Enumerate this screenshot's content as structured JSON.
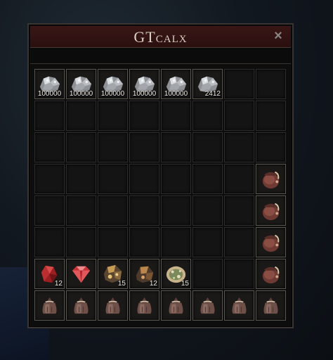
{
  "window": {
    "title": "GTcalx",
    "close_label": "×"
  },
  "grid": {
    "rows": [
      [
        {
          "item": "silver-ore-icon",
          "qty": "100000"
        },
        {
          "item": "silver-ore-icon",
          "qty": "100000"
        },
        {
          "item": "silver-ore-icon",
          "qty": "100000"
        },
        {
          "item": "silver-ore-icon",
          "qty": "100000"
        },
        {
          "item": "silver-ore-icon",
          "qty": "100000"
        },
        {
          "item": "silver-ore-icon",
          "qty": "2412"
        },
        null,
        null
      ],
      [
        null,
        null,
        null,
        null,
        null,
        null,
        null,
        null
      ],
      [
        null,
        null,
        null,
        null,
        null,
        null,
        null,
        null
      ],
      [
        null,
        null,
        null,
        null,
        null,
        null,
        null,
        {
          "item": "leather-pouch-icon",
          "qty": ""
        }
      ],
      [
        null,
        null,
        null,
        null,
        null,
        null,
        null,
        {
          "item": "leather-pouch-icon",
          "qty": ""
        }
      ],
      [
        null,
        null,
        null,
        null,
        null,
        null,
        null,
        {
          "item": "leather-pouch-icon",
          "qty": ""
        }
      ],
      [
        {
          "item": "red-crystal-icon",
          "qty": "12"
        },
        {
          "item": "ruby-gem-icon",
          "qty": ""
        },
        {
          "item": "ore-chunk-icon",
          "qty": "15"
        },
        {
          "item": "copper-ore-icon",
          "qty": "12"
        },
        {
          "item": "mossy-stone-icon",
          "qty": "15"
        },
        null,
        null,
        {
          "item": "leather-pouch-icon",
          "qty": ""
        }
      ],
      [
        {
          "item": "tied-sack-icon",
          "qty": ""
        },
        {
          "item": "tied-sack-icon",
          "qty": ""
        },
        {
          "item": "tied-sack-icon",
          "qty": ""
        },
        {
          "item": "tied-sack-icon",
          "qty": ""
        },
        {
          "item": "tied-sack-icon",
          "qty": ""
        },
        {
          "item": "tied-sack-icon",
          "qty": ""
        },
        {
          "item": "tied-sack-icon",
          "qty": ""
        },
        {
          "item": "tied-sack-icon",
          "qty": ""
        }
      ]
    ]
  }
}
